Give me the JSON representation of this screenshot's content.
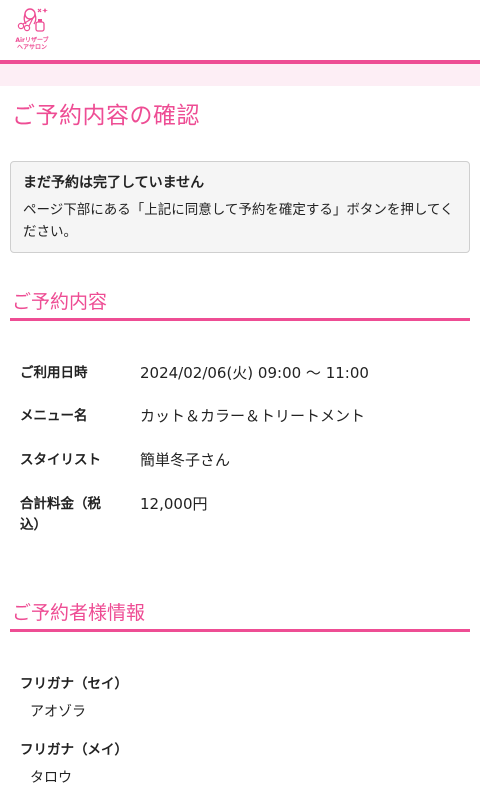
{
  "header": {
    "logo_lines": [
      "Airリザーブ",
      "ヘアサロン"
    ],
    "logo_icon": "hair-salon-logo-icon",
    "brand_color": "#ee4d94"
  },
  "page_title": "ご予約内容の確認",
  "notice": {
    "title": "まだ予約は完了していません",
    "body": "ページ下部にある「上記に同意して予約を確定する」ボタンを押してください。"
  },
  "reservation": {
    "heading": "ご予約内容",
    "rows": [
      {
        "label": "ご利用日時",
        "value": "2024/02/06(火) 09:00 〜 11:00"
      },
      {
        "label": "メニュー名",
        "value": "カット＆カラー＆トリートメント"
      },
      {
        "label": "スタイリスト",
        "value": "簡単冬子さん"
      },
      {
        "label": "合計料金（税込）",
        "value": "12,000円"
      }
    ]
  },
  "customer": {
    "heading": "ご予約者様情報",
    "fields": [
      {
        "label": "フリガナ（セイ）",
        "value": "アオゾラ"
      },
      {
        "label": "フリガナ（メイ）",
        "value": "タロウ"
      }
    ]
  }
}
